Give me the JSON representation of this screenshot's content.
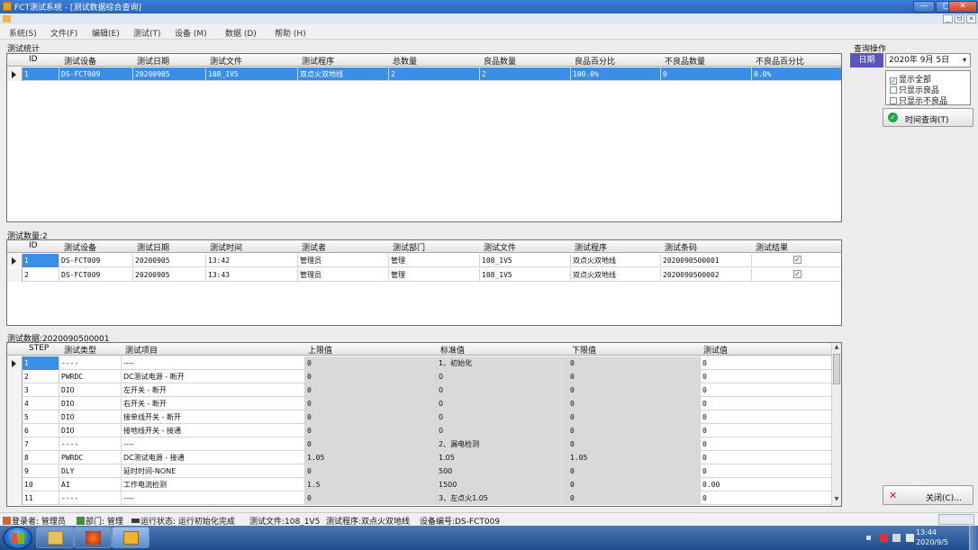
{
  "window": {
    "title": "FCT测试系统 - [测试数据综合查询]",
    "buttons": {
      "minimize": "—",
      "maximize": "□",
      "close": "✕"
    }
  },
  "mdi_buttons": [
    "_",
    "ᗢ",
    "✕"
  ],
  "menu": [
    "系统(S)",
    "文件(F)",
    "编辑(E)",
    "测试(T)",
    "设备 (M)",
    "数据 (D)",
    "帮助 (H)"
  ],
  "stats": {
    "section_label": "测试统计",
    "columns": [
      "ID",
      "测试设备",
      "测试日期",
      "测试文件",
      "测试程序",
      "总数量",
      "良品数量",
      "良品百分比",
      "不良品数量",
      "不良品百分比"
    ],
    "rows": [
      [
        "1",
        "DS-FCT009",
        "20200905",
        "108_1V5",
        "双点火双地线",
        "2",
        "2",
        "100.0%",
        "0",
        "0.0%"
      ]
    ]
  },
  "tests": {
    "section_label": "测试数量:2",
    "columns": [
      "ID",
      "测试设备",
      "测试日期",
      "测试时间",
      "测试者",
      "测试部门",
      "测试文件",
      "测试程序",
      "测试条码",
      "测试结果"
    ],
    "rows": [
      [
        "1",
        "DS-FCT009",
        "20200905",
        "13:42",
        "管理员",
        "管理",
        "108_1V5",
        "双点火双地线",
        "2020090500001",
        "✓"
      ],
      [
        "2",
        "DS-FCT009",
        "20200905",
        "13:43",
        "管理员",
        "管理",
        "108_1V5",
        "双点火双地线",
        "2020090500002",
        "✓"
      ]
    ]
  },
  "steps": {
    "section_label": "测试数据:2020090500001",
    "columns": [
      "STEP",
      "测试类型",
      "测试项目",
      "上限值",
      "标准值",
      "下限值",
      "测试值"
    ],
    "rows": [
      [
        "1",
        "----",
        "----",
        "0",
        "1、初始化",
        "0",
        "0"
      ],
      [
        "2",
        "PWRDC",
        "DC测试电源 - 断开",
        "0",
        "0",
        "0",
        "0"
      ],
      [
        "3",
        "DIO",
        "左开关 - 断开",
        "0",
        "0",
        "0",
        "0"
      ],
      [
        "4",
        "DIO",
        "右开关 - 断开",
        "0",
        "0",
        "0",
        "0"
      ],
      [
        "5",
        "DIO",
        "接单线开关 - 断开",
        "0",
        "0",
        "0",
        "0"
      ],
      [
        "6",
        "DIO",
        "接地线开关 - 接通",
        "0",
        "0",
        "0",
        "0"
      ],
      [
        "7",
        "----",
        "----",
        "0",
        "2、漏电检测",
        "0",
        "0"
      ],
      [
        "8",
        "PWRDC",
        "DC测试电源 - 接通",
        "1.05",
        "1.05",
        "1.05",
        "0"
      ],
      [
        "9",
        "DLY",
        "延时时间-NONE",
        "0",
        "500",
        "0",
        "0"
      ],
      [
        "10",
        "AI",
        "工作电流检测",
        "1.5",
        "1500",
        "0",
        "0.00"
      ],
      [
        "11",
        "----",
        "----",
        "0",
        "3、左点火1.05",
        "0",
        "0"
      ]
    ],
    "scroll_up": "▲",
    "scroll_down": "▼"
  },
  "query_panel": {
    "title": "查询操作",
    "date_label": "日期",
    "date_value": "2020年 9月 5日",
    "dropdown_glyph": "▾",
    "options": [
      {
        "label": "显示全部",
        "checked": true
      },
      {
        "label": "只显示良品",
        "checked": false
      },
      {
        "label": "只显示不良品",
        "checked": false
      }
    ],
    "query_button": "时间查询(T)",
    "close_button": "关闭(C)..."
  },
  "statusbar": {
    "login": "登录者: 管理员",
    "dept": "部门: 管理",
    "run_state": "运行状态: 运行初始化完成",
    "test_file": "测试文件:108_1V5",
    "test_program": "测试程序:双点火双地线",
    "device": "设备编号:DS-FCT009"
  },
  "taskbar": {
    "time": "13:44",
    "date": "2020/9/5"
  },
  "colors": {
    "selection": "#3b8ee5",
    "date_label_bg": "#5b55c0",
    "titlebar": "#2a63b8"
  }
}
